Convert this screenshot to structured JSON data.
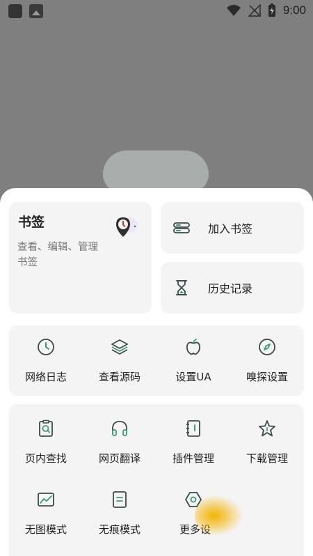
{
  "status_bar": {
    "time": "9:00"
  },
  "bookmark_card": {
    "title": "书签",
    "description": "查看、编辑、管理书签"
  },
  "side_actions": [
    {
      "label": "加入书签",
      "icon": "bookmark-add-icon"
    },
    {
      "label": "历史记录",
      "icon": "hourglass-icon"
    }
  ],
  "tools_row1": [
    {
      "label": "网络日志",
      "icon": "clock-icon"
    },
    {
      "label": "查看源码",
      "icon": "layers-icon"
    },
    {
      "label": "设置UA",
      "icon": "apple-icon"
    },
    {
      "label": "嗅探设置",
      "icon": "compass-icon"
    }
  ],
  "tools_row2": [
    {
      "label": "页内查找",
      "icon": "page-search-icon"
    },
    {
      "label": "网页翻译",
      "icon": "headphones-icon"
    },
    {
      "label": "插件管理",
      "icon": "notebook-icon"
    },
    {
      "label": "下载管理",
      "icon": "star-icon"
    }
  ],
  "tools_row3": [
    {
      "label": "无图模式",
      "icon": "image-icon"
    },
    {
      "label": "无痕模式",
      "icon": "document-icon"
    },
    {
      "label": "更多设",
      "icon": "settings-icon"
    }
  ],
  "colors": {
    "accent": "#3a9b7c",
    "icon_stroke": "#3b4a4a",
    "background_dim": "#7f7f7f"
  }
}
